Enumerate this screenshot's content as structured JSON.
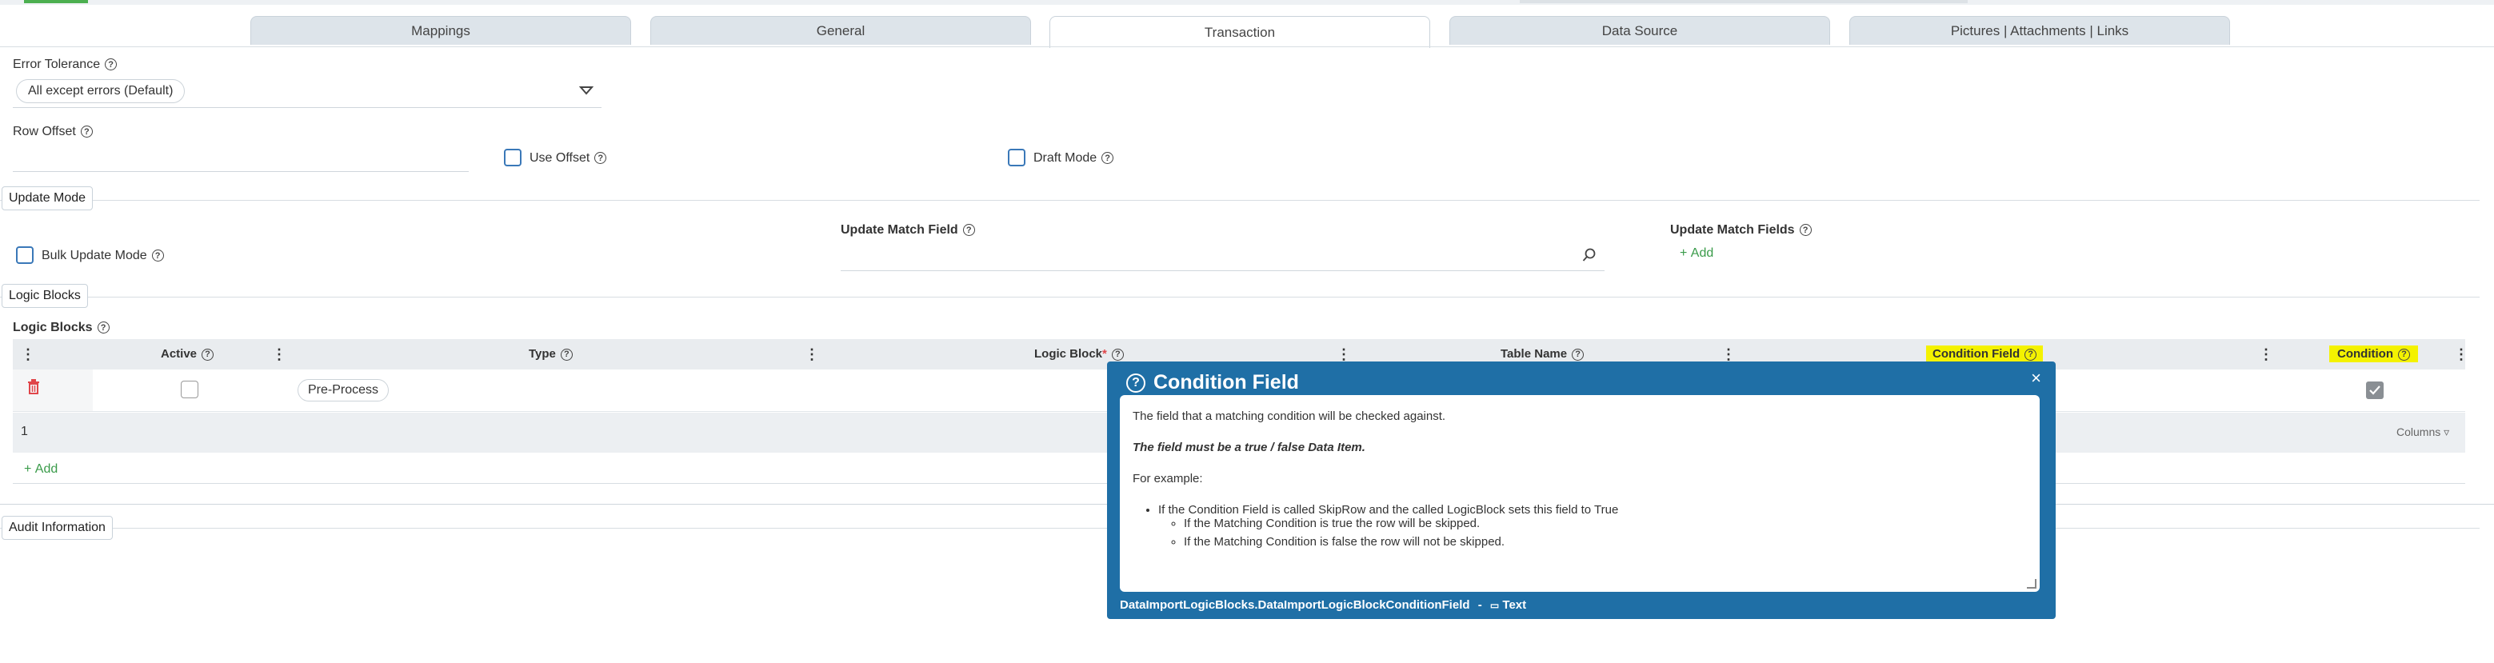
{
  "tabs": [
    "Mappings",
    "General",
    "Transaction",
    "Data Source",
    "Pictures | Attachments | Links"
  ],
  "active_tab": "Transaction",
  "error_tolerance": {
    "label": "Error Tolerance",
    "value": "All except errors (Default)"
  },
  "row_offset": {
    "label": "Row Offset",
    "value": ""
  },
  "use_offset": {
    "label": "Use Offset",
    "checked": false
  },
  "draft_mode": {
    "label": "Draft Mode",
    "checked": false
  },
  "update_mode": {
    "section": "Update Mode",
    "bulk_update_label": "Bulk Update Mode",
    "match_field_label": "Update Match Field",
    "match_field_value": "",
    "match_fields_label": "Update Match Fields",
    "add_label": "Add"
  },
  "logic_blocks": {
    "section": "Logic Blocks",
    "title": "Logic Blocks",
    "columns": {
      "active": "Active",
      "type": "Type",
      "logic_block": "Logic Block",
      "table_name": "Table Name",
      "condition_field": "Condition Field",
      "condition": "Condition"
    },
    "rows": [
      {
        "active": false,
        "type": "Pre-Process",
        "condition": true
      }
    ],
    "count": "1",
    "columns_button": "Columns",
    "add_label": "Add"
  },
  "audit": {
    "section": "Audit Information"
  },
  "tooltip": {
    "title": "Condition Field",
    "close": "×",
    "line1": "The field that a matching condition will be checked against.",
    "line2": "The field must be a true / false Data Item.",
    "line3": "For example:",
    "bullet": "If the Condition Field is called SkipRow and the called LogicBlock sets this field to True",
    "sub1": "If the Matching Condition is true the row will be skipped.",
    "sub2": "If the Matching Condition is false the row will not be skipped.",
    "footer_path": "DataImportLogicBlocks.DataImportLogicBlockConditionField",
    "footer_sep": "-",
    "footer_type": "Text"
  },
  "colors": {
    "accent": "#1f6fa6",
    "highlight": "#f4f200",
    "add_green": "#3a9b4a",
    "delete_red": "#e0464a"
  }
}
